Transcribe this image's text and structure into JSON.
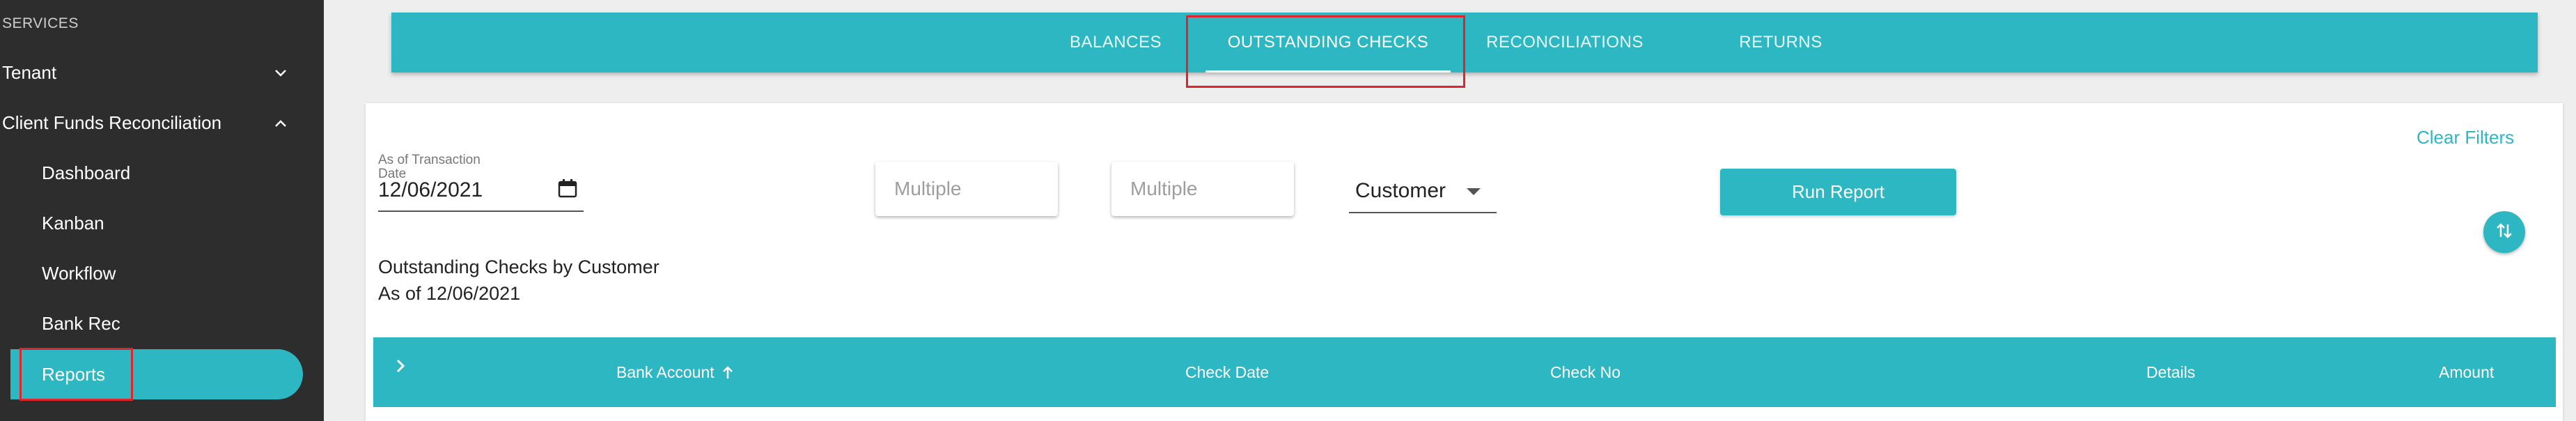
{
  "sidebar": {
    "section_label": "SERVICES",
    "items": [
      {
        "label": "Tenant",
        "chevron": "chevron-down-icon"
      },
      {
        "label": "Client Funds Reconciliation",
        "chevron": "chevron-up-icon"
      }
    ],
    "sub_items": [
      {
        "label": "Dashboard"
      },
      {
        "label": "Kanban"
      },
      {
        "label": "Workflow"
      },
      {
        "label": "Bank Rec"
      },
      {
        "label": "Reports",
        "active": true
      }
    ]
  },
  "tabs": [
    {
      "label": "BALANCES"
    },
    {
      "label": "OUTSTANDING CHECKS",
      "active": true
    },
    {
      "label": "RECONCILIATIONS"
    },
    {
      "label": "RETURNS"
    }
  ],
  "filters": {
    "clear_label": "Clear Filters",
    "date_label": "As of Transaction Date",
    "date_value": "12/06/2021",
    "multi1_placeholder": "Multiple",
    "multi2_placeholder": "Multiple",
    "group_by": "Customer",
    "run_label": "Run Report"
  },
  "report": {
    "title": "Outstanding Checks by Customer",
    "as_of": "As of 12/06/2021"
  },
  "table": {
    "columns": [
      "Bank Account",
      "Check Date",
      "Check No",
      "Details",
      "Amount"
    ]
  },
  "colors": {
    "accent": "#2db7c3",
    "sidebar_bg": "#2d2d2d",
    "highlight": "#e0242b"
  }
}
